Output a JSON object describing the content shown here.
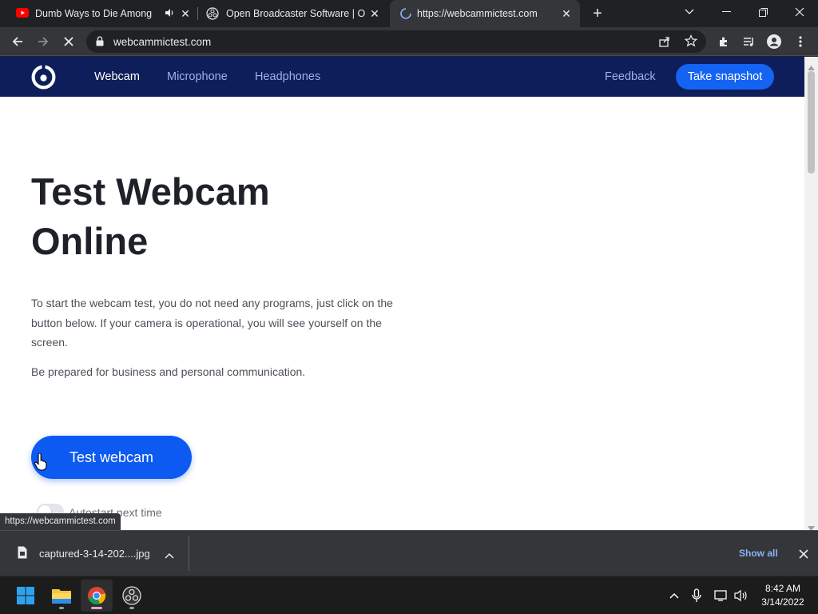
{
  "tabs": [
    {
      "title": "Dumb Ways to Die Among Us",
      "icon": "youtube-icon",
      "audio_icon": "speaker-icon"
    },
    {
      "title": "Open Broadcaster Software | OBS",
      "icon": "obs-icon"
    },
    {
      "title": "https://webcammictest.com",
      "icon": "loading-spinner-icon",
      "active": true
    }
  ],
  "toolbar": {
    "url": "webcammictest.com"
  },
  "site": {
    "nav": {
      "webcam": "Webcam",
      "microphone": "Microphone",
      "headphones": "Headphones",
      "feedback": "Feedback",
      "snapshot": "Take snapshot"
    },
    "hero_title": "Test Webcam Online",
    "intro": "To start the webcam test, you do not need any programs, just click on the button below. If your camera is operational, you will see yourself on the screen.",
    "prepared": "Be prepared for business and personal communication.",
    "test_button": "Test webcam",
    "autostart": "Autostart next time",
    "hover_link": "https://webcammictest.com"
  },
  "download": {
    "filename": "captured-3-14-202....jpg",
    "show_all": "Show all"
  },
  "taskbar": {
    "time": "8:42 AM",
    "date": "3/14/2022"
  },
  "colors": {
    "nav_bg": "#0d1e5a",
    "accent": "#1463f3",
    "chrome_bg": "#202124",
    "chrome_toolbar": "#35363a"
  }
}
